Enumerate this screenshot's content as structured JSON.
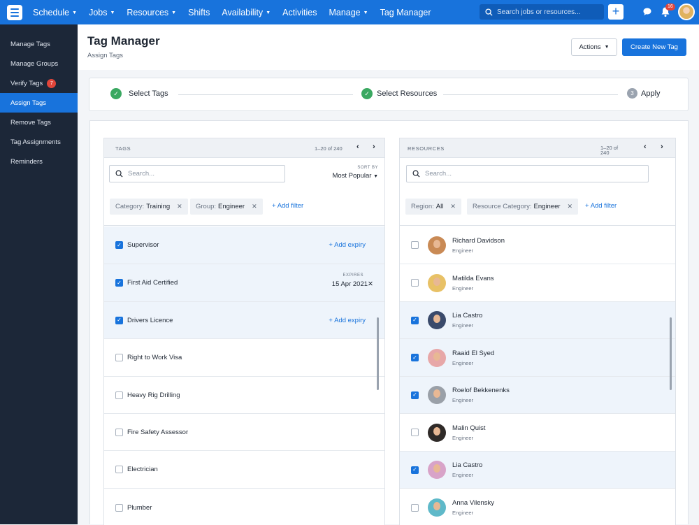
{
  "nav": {
    "items": [
      {
        "label": "Schedule",
        "dropdown": true
      },
      {
        "label": "Jobs",
        "dropdown": true
      },
      {
        "label": "Resources",
        "dropdown": true
      },
      {
        "label": "Shifts",
        "dropdown": false
      },
      {
        "label": "Availability",
        "dropdown": true
      },
      {
        "label": "Activities",
        "dropdown": false
      },
      {
        "label": "Manage",
        "dropdown": true
      },
      {
        "label": "Tag Manager",
        "dropdown": false
      }
    ],
    "search_placeholder": "Search jobs or resources...",
    "notification_count": "16",
    "accent": "#1873dc"
  },
  "sidebar": {
    "items": [
      {
        "label": "Manage Tags"
      },
      {
        "label": "Manage Groups"
      },
      {
        "label": "Verify Tags",
        "badge": "7"
      },
      {
        "label": "Assign Tags",
        "active": true
      },
      {
        "label": "Remove Tags"
      },
      {
        "label": "Tag Assignments"
      },
      {
        "label": "Reminders"
      }
    ]
  },
  "header": {
    "title": "Tag Manager",
    "subtitle": "Assign Tags",
    "actions_label": "Actions",
    "create_label": "Create New Tag"
  },
  "steps": [
    {
      "label": "Select Tags",
      "status": "done"
    },
    {
      "label": "Select Resources",
      "status": "done"
    },
    {
      "label": "Apply",
      "status": "pending",
      "number": "3"
    }
  ],
  "tags_panel": {
    "title": "TAGS",
    "pager": "1–20 of 240",
    "search_placeholder": "Search...",
    "sort_label": "SORT BY",
    "sort_value": "Most Popular",
    "filters": [
      {
        "key": "Category:",
        "value": "Training"
      },
      {
        "key": "Group:",
        "value": "Engineer"
      }
    ],
    "add_filter": "Add filter",
    "add_expiry": "Add expiry",
    "expires_label": "EXPIRES",
    "rows": [
      {
        "label": "Supervisor",
        "checked": true,
        "expiry": ""
      },
      {
        "label": "First Aid Certified",
        "checked": true,
        "expiry": "15 Apr 2021"
      },
      {
        "label": "Drivers Licence",
        "checked": true,
        "expiry": ""
      },
      {
        "label": "Right to Work Visa",
        "checked": false,
        "expiry": ""
      },
      {
        "label": "Heavy Rig Drilling",
        "checked": false,
        "expiry": ""
      },
      {
        "label": "Fire Safety Assessor",
        "checked": false,
        "expiry": ""
      },
      {
        "label": "Electrician",
        "checked": false,
        "expiry": ""
      },
      {
        "label": "Plumber",
        "checked": false,
        "expiry": ""
      }
    ]
  },
  "resources_panel": {
    "title": "RESOURCES",
    "pager_line1": "1–20 of",
    "pager_line2": "240",
    "search_placeholder": "Search...",
    "filters": [
      {
        "key": "Region:",
        "value": "All"
      },
      {
        "key": "Resource Category:",
        "value": "Engineer"
      }
    ],
    "add_filter": "Add filter",
    "rows": [
      {
        "name": "Richard Davidson",
        "role": "Engineer",
        "checked": false,
        "avatar_color": "#c98a55"
      },
      {
        "name": "Matilda Evans",
        "role": "Engineer",
        "checked": false,
        "avatar_color": "#e8c166"
      },
      {
        "name": "Lia Castro",
        "role": "Engineer",
        "checked": true,
        "avatar_color": "#3a4a6b"
      },
      {
        "name": "Raaid El Syed",
        "role": "Engineer",
        "checked": true,
        "avatar_color": "#e7a7a8"
      },
      {
        "name": "Roelof Bekkenenks",
        "role": "Engineer",
        "checked": true,
        "avatar_color": "#9aa0a8"
      },
      {
        "name": "Malin Quist",
        "role": "Engineer",
        "checked": false,
        "avatar_color": "#2f2a28"
      },
      {
        "name": "Lia Castro",
        "role": "Engineer",
        "checked": true,
        "avatar_color": "#d8a3c8"
      },
      {
        "name": "Anna Vilensky",
        "role": "Engineer",
        "checked": false,
        "avatar_color": "#5fb9c9"
      }
    ]
  }
}
